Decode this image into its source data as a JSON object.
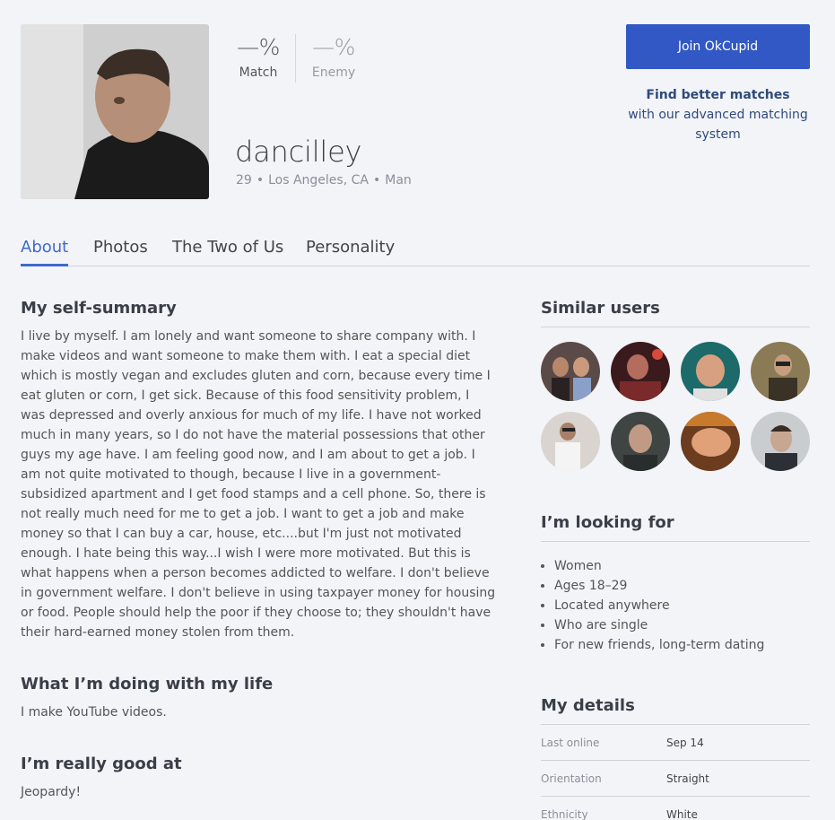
{
  "profile": {
    "username": "dancilley",
    "age": "29",
    "location": "Los Angeles, CA",
    "gender": "Man",
    "separator": "•"
  },
  "match": {
    "value": "—%",
    "label": "Match"
  },
  "enemy": {
    "value": "—%",
    "label": "Enemy"
  },
  "cta": {
    "join_label": "Join OkCupid",
    "promo_title": "Find better matches",
    "promo_sub": "with our advanced matching system"
  },
  "tabs": [
    {
      "label": "About",
      "active": true
    },
    {
      "label": "Photos"
    },
    {
      "label": "The Two of Us"
    },
    {
      "label": "Personality"
    }
  ],
  "essays": [
    {
      "title": "My self-summary",
      "body": "I live by myself. I am lonely and want someone to share company with. I make videos and want someone to make them with. I eat a special diet which is mostly vegan and excludes gluten and corn, because every time I eat gluten or corn, I get sick. Because of this food sensitivity problem, I was depressed and overly anxious for much of my life. I have not worked much in many years, so I do not have the material possessions that other guys my age have. I am feeling good now, and I am about to get a job. I am not quite motivated to though, because I live in a government-subsidized apartment and I get food stamps and a cell phone. So, there is not really much need for me to get a job. I want to get a job and make money so that I can buy a car, house, etc....but I'm just not motivated enough. I hate being this way...I wish I were more motivated. But this is what happens when a person becomes addicted to welfare. I don't believe in government welfare. I don't believe in using taxpayer money for housing or food. People should help the poor if they choose to; they shouldn't have their hard-earned money stolen from them."
    },
    {
      "title": "What I’m doing with my life",
      "body": "I make YouTube videos."
    },
    {
      "title": "I’m really good at",
      "body": "Jeopardy!"
    }
  ],
  "similar_users": {
    "title": "Similar users",
    "count": 8
  },
  "looking_for": {
    "title": "I’m looking for",
    "items": [
      "Women",
      "Ages 18–29",
      "Located anywhere",
      "Who are single",
      "For new friends, long-term dating"
    ]
  },
  "details": {
    "title": "My details",
    "rows": [
      {
        "key": "Last online",
        "value": "Sep 14"
      },
      {
        "key": "Orientation",
        "value": "Straight"
      },
      {
        "key": "Ethnicity",
        "value": "White"
      }
    ]
  },
  "colors": {
    "accent": "#3f6ac9",
    "button": "#3258c5",
    "promo_text": "#2d4a7a"
  }
}
